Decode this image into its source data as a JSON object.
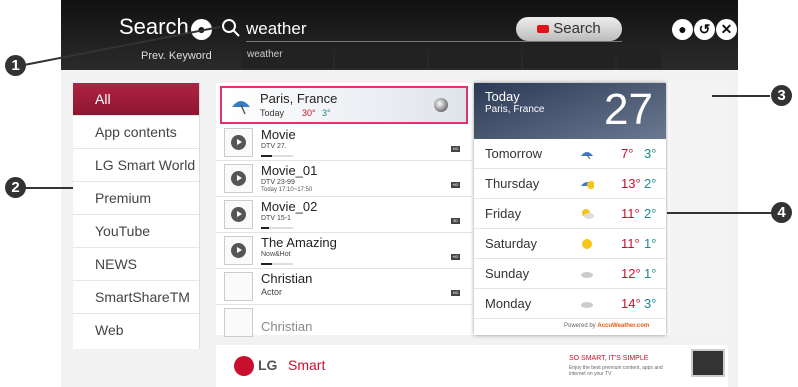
{
  "header": {
    "title": "Search",
    "query": "weather",
    "search_button": "Search",
    "prev_keyword_label": "Prev. Keyword",
    "prev_keywords": [
      "weather",
      "",
      "",
      "",
      ""
    ]
  },
  "sidebar": {
    "items": [
      {
        "label": "All",
        "active": true
      },
      {
        "label": "App contents"
      },
      {
        "label": "LG Smart World"
      },
      {
        "label": "Premium"
      },
      {
        "label": "YouTube"
      },
      {
        "label": "NEWS"
      },
      {
        "label": "SmartShareTM"
      },
      {
        "label": "Web"
      }
    ]
  },
  "weather_result": {
    "city": "Paris, France",
    "day": "Today",
    "high": "30°",
    "low": "3°"
  },
  "results": [
    {
      "title": "Movie",
      "line1": "DTV 27.",
      "line2": "",
      "progress": 0.35,
      "badge": "HD"
    },
    {
      "title": "Movie_01",
      "line1": "DTV 23-99",
      "line2": "Today 17:10~17:50",
      "progress": 0.3,
      "badge": "HD"
    },
    {
      "title": "Movie_02",
      "line1": "DTV 15-1",
      "line2": "",
      "progress": 0.25,
      "badge": "3D"
    },
    {
      "title": "The Amazing",
      "line1": "Now&Hot",
      "line2": "",
      "progress": 0.35,
      "badge": "HD"
    },
    {
      "title": "Christian",
      "line1": "Actor",
      "line2": "",
      "progress": 0,
      "badge": "HD"
    },
    {
      "title": "Christian",
      "line1": "",
      "line2": "",
      "progress": 0,
      "badge": ""
    }
  ],
  "weather_card": {
    "today_label": "Today",
    "city": "Paris, France",
    "temp": "27",
    "forecast": [
      {
        "day": "Tomorrow",
        "icon": "umbrella-icon",
        "high": "7°",
        "low": "3°"
      },
      {
        "day": "Thursday",
        "icon": "umbrella-sun-icon",
        "high": "13°",
        "low": "2°"
      },
      {
        "day": "Friday",
        "icon": "partly-cloudy-icon",
        "high": "11°",
        "low": "2°"
      },
      {
        "day": "Saturday",
        "icon": "sun-icon",
        "high": "11°",
        "low": "1°"
      },
      {
        "day": "Sunday",
        "icon": "cloud-icon",
        "high": "12°",
        "low": "1°"
      },
      {
        "day": "Monday",
        "icon": "cloud-icon",
        "high": "14°",
        "low": "3°"
      }
    ],
    "powered_by": "Powered by",
    "brand": "AccuWeather.com"
  },
  "ad": {
    "lg": "LG",
    "smart": "Smart",
    "tag": "SO SMART, IT'S SIMPLE",
    "sub": "Enjoy the best premium content, apps and internet on your TV"
  },
  "callouts": [
    "1",
    "2",
    "3",
    "4"
  ],
  "colors": {
    "accent": "#e2336e",
    "sidebar_active": "#9e1b3a",
    "hi_temp": "#c8102e",
    "lo_temp": "#1d8a8a"
  }
}
